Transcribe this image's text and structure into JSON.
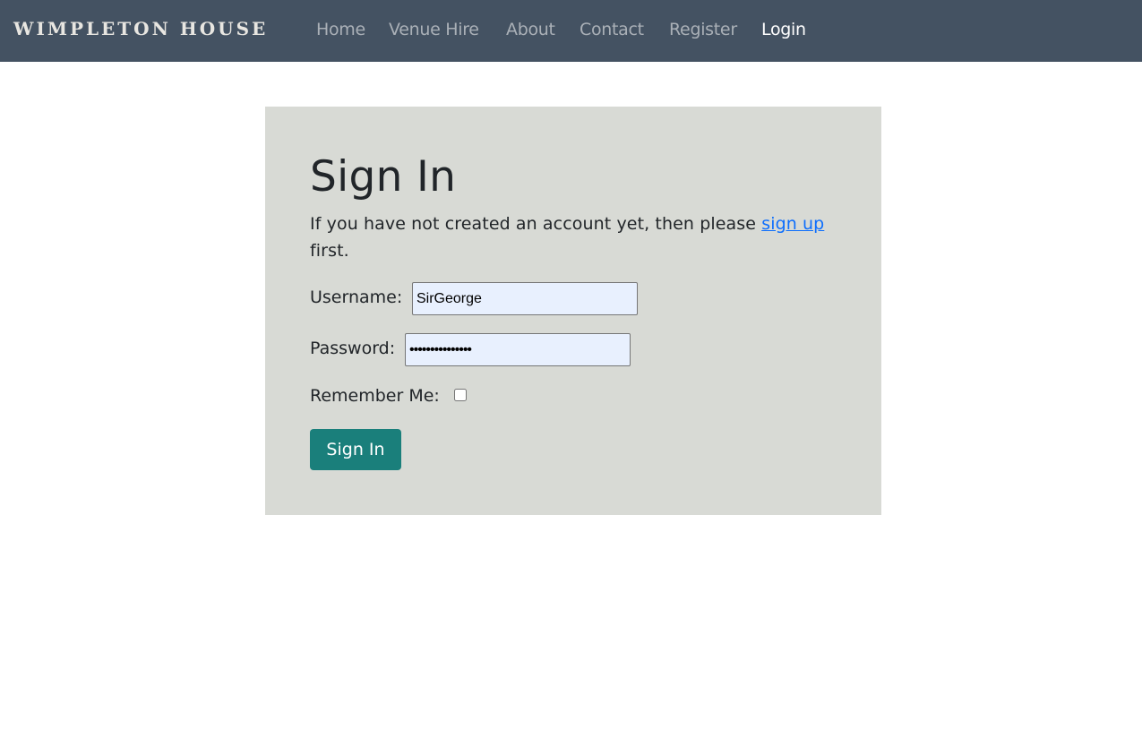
{
  "navbar": {
    "brand": "WIMPLETON HOUSE",
    "links": [
      {
        "label": "Home"
      },
      {
        "label": "Venue Hire"
      },
      {
        "label": "About"
      },
      {
        "label": "Contact"
      },
      {
        "label": "Register"
      },
      {
        "label": "Login",
        "active": true
      }
    ]
  },
  "signin": {
    "title": "Sign In",
    "intro_before": "If you have not created an account yet, then please ",
    "intro_link": "sign up",
    "intro_after": " first.",
    "username_label": "Username:",
    "username_value": "SirGeorge",
    "password_label": "Password:",
    "password_value": "•••••••••••••••",
    "remember_label": "Remember Me:",
    "remember_checked": false,
    "submit_label": "Sign In"
  },
  "colors": {
    "navbar_bg": "#445262",
    "card_bg": "#d8dad5",
    "button_bg": "#1a7f7b",
    "link": "#0d6efd",
    "autofill_bg": "#e8f0fe"
  }
}
